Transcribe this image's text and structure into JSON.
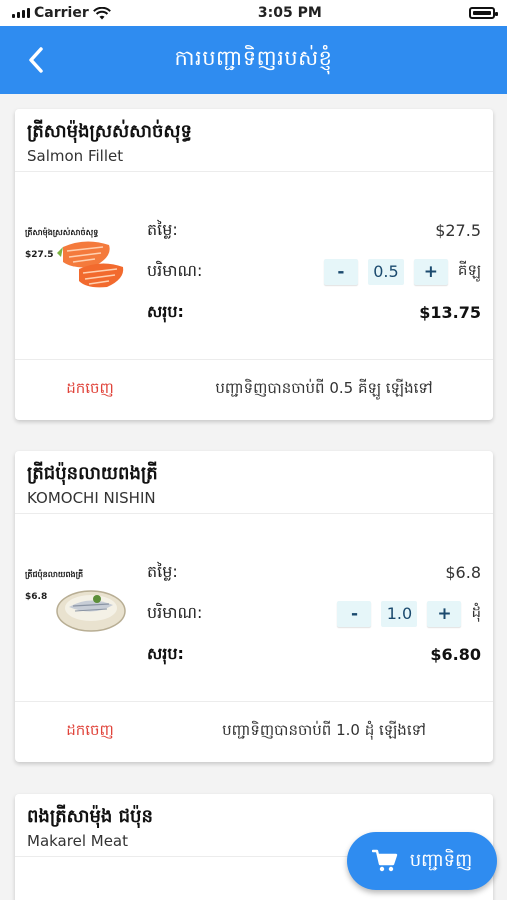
{
  "status_bar": {
    "carrier": "Carrier",
    "time": "3:05 PM"
  },
  "nav": {
    "title": "ការបញ្ជាទិញរបស់ខ្ញុំ"
  },
  "labels": {
    "price": "តម្លៃ:",
    "quantity": "បរិមាណ:",
    "total": "សរុប:",
    "remove": "ដកចេញ",
    "minus": "-",
    "plus": "+"
  },
  "items": [
    {
      "name_km": "ត្រីសាម៉ុងស្រស់សាច់សុទ្ធ",
      "name_en": "Salmon Fillet",
      "image_caption": "ត្រីសាម៉ុងស្រស់សាច់សុទ្ធ",
      "image_price": "$27.5",
      "price": "$27.5",
      "quantity": "0.5",
      "unit": "គីឡូ",
      "total": "$13.75",
      "min_note": "បញ្ជាទិញបានចាប់ពី 0.5 គីឡូ ឡើងទៅ"
    },
    {
      "name_km": "ត្រីជប៉ុនលាយពងត្រី",
      "name_en": "KOMOCHI NISHIN",
      "image_caption": "ត្រីជប៉ុនលាយពងត្រី",
      "image_price": "$6.8",
      "price": "$6.8",
      "quantity": "1.0",
      "unit": "ដុំ",
      "total": "$6.80",
      "min_note": "បញ្ជាទិញបានចាប់ពី 1.0 ដុំ ឡើងទៅ"
    },
    {
      "name_km": "ពងត្រីសាម៉ុង ជប៉ុន",
      "name_en": "Makarel Meat"
    }
  ],
  "cart_button": {
    "label": "បញ្ជាទិញ"
  },
  "colors": {
    "primary": "#2f8cf0",
    "remove": "#e0443b",
    "qty_bg": "#e6f6f9"
  }
}
